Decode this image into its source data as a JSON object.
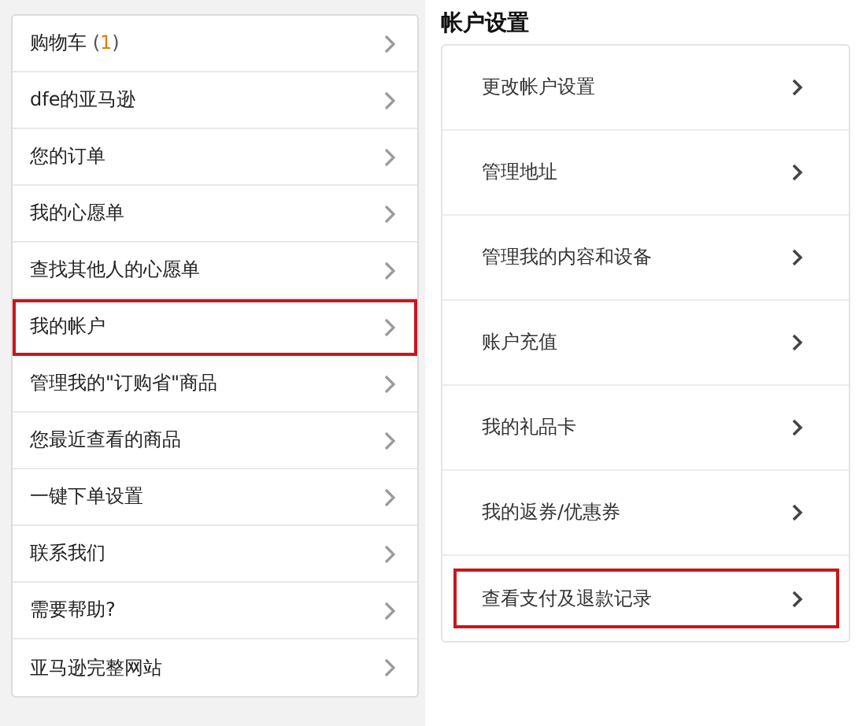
{
  "menu": [
    {
      "label": "购物车",
      "count_prefix": " (",
      "count": "1",
      "count_suffix": ")",
      "selected": false
    },
    {
      "label": "dfe的亚马逊",
      "selected": false
    },
    {
      "label": "您的订单",
      "selected": false
    },
    {
      "label": "我的心愿单",
      "selected": false
    },
    {
      "label": "查找其他人的心愿单",
      "selected": false
    },
    {
      "label": "我的帐户",
      "selected": true
    },
    {
      "label": "管理我的\"订购省\"商品",
      "selected": false
    },
    {
      "label": "您最近查看的商品",
      "selected": false
    },
    {
      "label": "一键下单设置",
      "selected": false
    },
    {
      "label": "联系我们",
      "selected": false
    },
    {
      "label": "需要帮助?",
      "selected": false
    },
    {
      "label": "亚马逊完整网站",
      "selected": false
    }
  ],
  "account_settings": {
    "title": "帐户设置",
    "items": [
      {
        "label": "更改帐户设置",
        "selected": false
      },
      {
        "label": "管理地址",
        "selected": false
      },
      {
        "label": "管理我的内容和设备",
        "selected": false
      },
      {
        "label": "账户充值",
        "selected": false
      },
      {
        "label": "我的礼品卡",
        "selected": false
      },
      {
        "label": "我的返券/优惠券",
        "selected": false
      },
      {
        "label": "查看支付及退款记录",
        "selected": true
      }
    ]
  }
}
